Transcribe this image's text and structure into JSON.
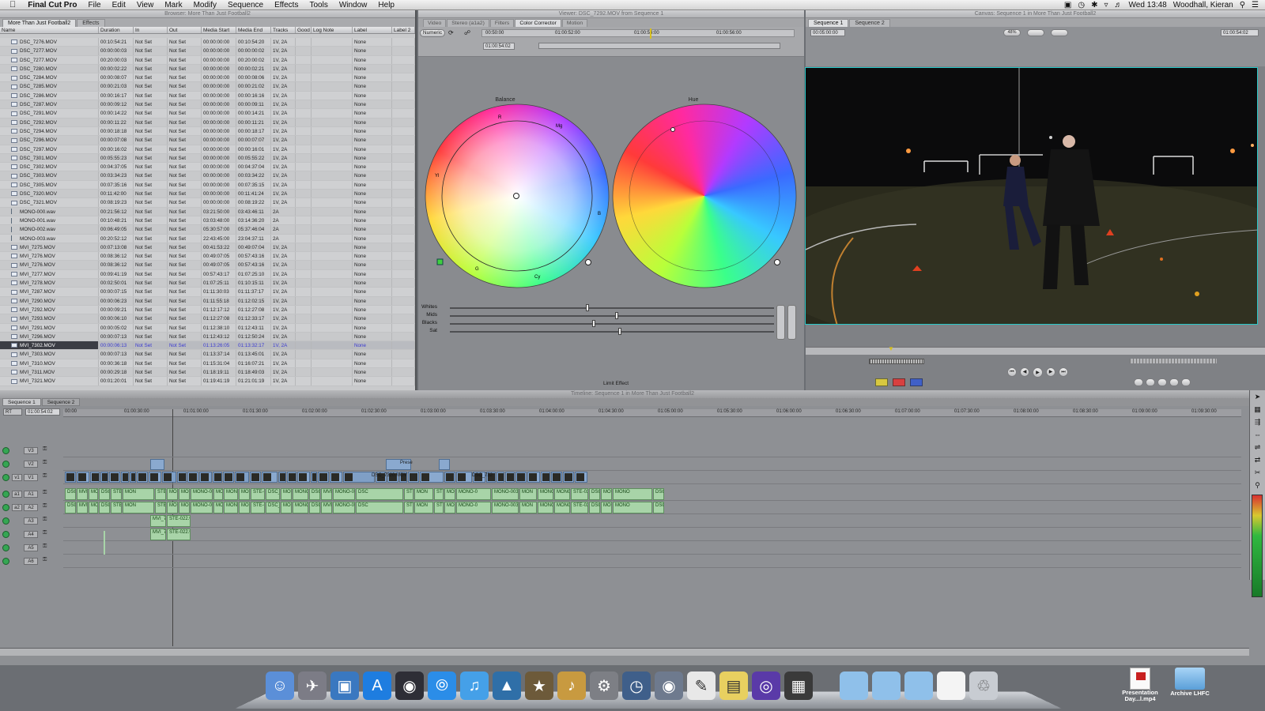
{
  "menubar": {
    "app": "Final Cut Pro",
    "items": [
      "File",
      "Edit",
      "View",
      "Mark",
      "Modify",
      "Sequence",
      "Effects",
      "Tools",
      "Window",
      "Help"
    ],
    "clock": "Wed 13:48",
    "user": "Woodhall, Kieran"
  },
  "browser": {
    "title": "Browser: More Than Just Football2",
    "tabs": [
      "More Than Just Football2",
      "Effects"
    ],
    "columns": [
      "Name",
      "Duration",
      "In",
      "Out",
      "Media Start",
      "Media End",
      "Tracks",
      "Good",
      "Log Note",
      "Label",
      "Label 2"
    ],
    "rows": [
      [
        "DSC_7276.MOV",
        "00:10:54:21",
        "Not Set",
        "Not Set",
        "00:00:00:00",
        "00:10:54:20",
        "1V, 2A",
        "None"
      ],
      [
        "DSC_7277.MOV",
        "00:00:00:03",
        "Not Set",
        "Not Set",
        "00:00:00:00",
        "00:00:00:02",
        "1V, 2A",
        "None"
      ],
      [
        "DSC_7277.MOV",
        "00:20:00:03",
        "Not Set",
        "Not Set",
        "00:00:00:00",
        "00:20:00:02",
        "1V, 2A",
        "None"
      ],
      [
        "DSC_7280.MOV",
        "00:00:02:22",
        "Not Set",
        "Not Set",
        "00:00:00:00",
        "00:00:02:21",
        "1V, 2A",
        "None"
      ],
      [
        "DSC_7284.MOV",
        "00:00:08:07",
        "Not Set",
        "Not Set",
        "00:00:00:00",
        "00:00:08:06",
        "1V, 2A",
        "None"
      ],
      [
        "DSC_7285.MOV",
        "00:00:21:03",
        "Not Set",
        "Not Set",
        "00:00:00:00",
        "00:00:21:02",
        "1V, 2A",
        "None"
      ],
      [
        "DSC_7286.MOV",
        "00:00:16:17",
        "Not Set",
        "Not Set",
        "00:00:00:00",
        "00:00:16:16",
        "1V, 2A",
        "None"
      ],
      [
        "DSC_7287.MOV",
        "00:00:09:12",
        "Not Set",
        "Not Set",
        "00:00:00:00",
        "00:00:09:11",
        "1V, 2A",
        "None"
      ],
      [
        "DSC_7291.MOV",
        "00:00:14:22",
        "Not Set",
        "Not Set",
        "00:00:00:00",
        "00:00:14:21",
        "1V, 2A",
        "None"
      ],
      [
        "DSC_7292.MOV",
        "00:00:11:22",
        "Not Set",
        "Not Set",
        "00:00:00:00",
        "00:00:11:21",
        "1V, 2A",
        "None"
      ],
      [
        "DSC_7294.MOV",
        "00:00:18:18",
        "Not Set",
        "Not Set",
        "00:00:00:00",
        "00:00:18:17",
        "1V, 2A",
        "None"
      ],
      [
        "DSC_7296.MOV",
        "00:00:07:08",
        "Not Set",
        "Not Set",
        "00:00:00:00",
        "00:00:07:07",
        "1V, 2A",
        "None"
      ],
      [
        "DSC_7297.MOV",
        "00:00:16:02",
        "Not Set",
        "Not Set",
        "00:00:00:00",
        "00:00:16:01",
        "1V, 2A",
        "None"
      ],
      [
        "DSC_7301.MOV",
        "00:05:55:23",
        "Not Set",
        "Not Set",
        "00:00:00:00",
        "00:05:55:22",
        "1V, 2A",
        "None"
      ],
      [
        "DSC_7302.MOV",
        "00:04:37:05",
        "Not Set",
        "Not Set",
        "00:00:00:00",
        "00:04:37:04",
        "1V, 2A",
        "None"
      ],
      [
        "DSC_7303.MOV",
        "00:03:34:23",
        "Not Set",
        "Not Set",
        "00:00:00:00",
        "00:03:34:22",
        "1V, 2A",
        "None"
      ],
      [
        "DSC_7305.MOV",
        "00:07:35:16",
        "Not Set",
        "Not Set",
        "00:00:00:00",
        "00:07:35:15",
        "1V, 2A",
        "None"
      ],
      [
        "DSC_7320.MOV",
        "00:11:42:00",
        "Not Set",
        "Not Set",
        "00:00:00:00",
        "00:11:41:24",
        "1V, 2A",
        "None"
      ],
      [
        "DSC_7321.MOV",
        "00:08:19:23",
        "Not Set",
        "Not Set",
        "00:00:00:00",
        "00:08:19:22",
        "1V, 2A",
        "None"
      ],
      [
        "MONO-000.wav",
        "00:21:56:12",
        "Not Set",
        "Not Set",
        "03:21:50:00",
        "03:43:46:11",
        "2A",
        "None"
      ],
      [
        "MONO-001.wav",
        "00:10:48:21",
        "Not Set",
        "Not Set",
        "03:03:48:00",
        "03:14:36:20",
        "2A",
        "None"
      ],
      [
        "MONO-002.wav",
        "00:06:49:05",
        "Not Set",
        "Not Set",
        "05:30:57:00",
        "05:37:46:04",
        "2A",
        "None"
      ],
      [
        "MONO-003.wav",
        "00:20:52:12",
        "Not Set",
        "Not Set",
        "22:43:45:00",
        "23:04:37:11",
        "2A",
        "None"
      ],
      [
        "MVI_7275.MOV",
        "00:07:13:08",
        "Not Set",
        "Not Set",
        "00:41:53:22",
        "00:49:07:04",
        "1V, 2A",
        "None"
      ],
      [
        "MVI_7276.MOV",
        "00:08:36:12",
        "Not Set",
        "Not Set",
        "00:49:07:05",
        "00:57:43:16",
        "1V, 2A",
        "None"
      ],
      [
        "MVI_7276.MOV",
        "00:08:36:12",
        "Not Set",
        "Not Set",
        "00:49:07:05",
        "00:57:43:16",
        "1V, 2A",
        "None"
      ],
      [
        "MVI_7277.MOV",
        "00:09:41:19",
        "Not Set",
        "Not Set",
        "00:57:43:17",
        "01:07:25:10",
        "1V, 2A",
        "None"
      ],
      [
        "MVI_7278.MOV",
        "00:02:50:01",
        "Not Set",
        "Not Set",
        "01:07:25:11",
        "01:10:15:11",
        "1V, 2A",
        "None"
      ],
      [
        "MVI_7287.MOV",
        "00:00:07:15",
        "Not Set",
        "Not Set",
        "01:11:30:03",
        "01:11:37:17",
        "1V, 2A",
        "None"
      ],
      [
        "MVI_7290.MOV",
        "00:00:06:23",
        "Not Set",
        "Not Set",
        "01:11:55:18",
        "01:12:02:15",
        "1V, 2A",
        "None"
      ],
      [
        "MVI_7292.MOV",
        "00:00:09:21",
        "Not Set",
        "Not Set",
        "01:12:17:12",
        "01:12:27:08",
        "1V, 2A",
        "None"
      ],
      [
        "MVI_7293.MOV",
        "00:00:06:10",
        "Not Set",
        "Not Set",
        "01:12:27:08",
        "01:12:33:17",
        "1V, 2A",
        "None"
      ],
      [
        "MVI_7291.MOV",
        "00:00:05:02",
        "Not Set",
        "Not Set",
        "01:12:38:10",
        "01:12:43:11",
        "1V, 2A",
        "None"
      ],
      [
        "MVI_7296.MOV",
        "00:00:07:13",
        "Not Set",
        "Not Set",
        "01:12:43:12",
        "01:12:50:24",
        "1V, 2A",
        "None"
      ],
      [
        "MVI_7302.MOV",
        "00:00:06:13",
        "Not Set",
        "Not Set",
        "01:13:26:05",
        "01:13:32:17",
        "1V, 2A",
        "None"
      ],
      [
        "MVI_7303.MOV",
        "00:00:07:13",
        "Not Set",
        "Not Set",
        "01:13:37:14",
        "01:13:45:01",
        "1V, 2A",
        "None"
      ],
      [
        "MVI_7310.MOV",
        "00:00:36:18",
        "Not Set",
        "Not Set",
        "01:15:31:04",
        "01:16:07:21",
        "1V, 2A",
        "None"
      ],
      [
        "MVI_7311.MOV",
        "00:00:29:18",
        "Not Set",
        "Not Set",
        "01:18:19:11",
        "01:18:49:03",
        "1V, 2A",
        "None"
      ],
      [
        "MVI_7321.MOV",
        "00:01:20:01",
        "Not Set",
        "Not Set",
        "01:19:41:19",
        "01:21:01:19",
        "1V, 2A",
        "None"
      ]
    ],
    "selected_row": 34
  },
  "viewer": {
    "title": "Viewer: DSC_7292.MOV from Sequence 1",
    "tabs": [
      "Video",
      "Stereo (a1a2)",
      "Filters",
      "Color Corrector",
      "Motion"
    ],
    "active_tab": "Color Corrector",
    "numeric_label": "Numeric",
    "timecode": "01:00:54:02",
    "ruler": [
      "00:50:00",
      "01:00:52:00",
      "01:00:54:00",
      "01:00:56:00"
    ],
    "balance_label": "Balance",
    "hue_label": "Hue",
    "wheel_marks": {
      "r": "R",
      "mg": "Mg",
      "yl": "Yl",
      "b": "B",
      "g": "G",
      "cy": "Cy"
    },
    "sliders": [
      {
        "label": "Whites",
        "value": 0.42
      },
      {
        "label": "Mids",
        "value": 0.51
      },
      {
        "label": "Blacks",
        "value": 0.44
      },
      {
        "label": "Sat",
        "value": 0.52
      }
    ],
    "limit_effect": "Limit Effect"
  },
  "canvas": {
    "title": "Canvas: Sequence 1 in More Than Just Football2",
    "tabs": [
      "Sequence 1",
      "Sequence 2"
    ],
    "duration": "00:05:00:00",
    "zoom": "48%",
    "timecode": "01:00:54:02"
  },
  "timeline": {
    "title": "Timeline: Sequence 1 in More Than Just Football2",
    "tabs": [
      "Sequence 1",
      "Sequence 2"
    ],
    "rt": "RT",
    "timecode": "01:00:54:02",
    "ruler": [
      "00:00",
      "01:00:30:00",
      "01:01:00:00",
      "01:01:30:00",
      "01:02:00:00",
      "01:02:30:00",
      "01:03:00:00",
      "01:03:30:00",
      "01:04:00:00",
      "01:04:30:00",
      "01:05:00:00",
      "01:05:30:00",
      "01:06:00:00",
      "01:06:30:00",
      "01:07:00:00",
      "01:07:30:00",
      "01:08:00:00",
      "01:08:30:00",
      "01:09:00:00",
      "01:09:30:00"
    ],
    "tracks": [
      "V3",
      "V2",
      "V1",
      "A1",
      "A2",
      "A3",
      "A4",
      "A5",
      "A6"
    ],
    "src_tracks": {
      "v1": "v1",
      "a1": "a1",
      "a2": "a2"
    },
    "v1_clips": [
      "DSC_7320.MOV",
      "DSC_732"
    ],
    "v2_clip": "Prese",
    "a_clips": [
      "DSC",
      "MVI",
      "MONO-000.w",
      "DSC",
      "STE-022",
      "MON",
      "STE",
      "MONO-00",
      "MONO-0",
      "MONO-003.wav",
      "MON",
      "MONO-0",
      "MONO-003.wav",
      "STE-022.wav",
      "DSC_73",
      "MONO-000.wav",
      "MONO"
    ],
    "a3_clips": [
      "MVI_7",
      "STE-022.w"
    ]
  },
  "dock": {
    "items": [
      "Finder",
      "Launchpad",
      "Image Capture",
      "App Store",
      "Dashboard",
      "Safari",
      "iTunes",
      "iPhoto",
      "iMovie",
      "GarageBand",
      "System Preferences",
      "Time Machine",
      "FaceTime",
      "TextEdit",
      "Stickies",
      "Final Cut Pro",
      "Compressor"
    ],
    "files": [
      {
        "label": "Presentation Day...l.mp4"
      },
      {
        "label": "Archive LHFC"
      }
    ]
  }
}
